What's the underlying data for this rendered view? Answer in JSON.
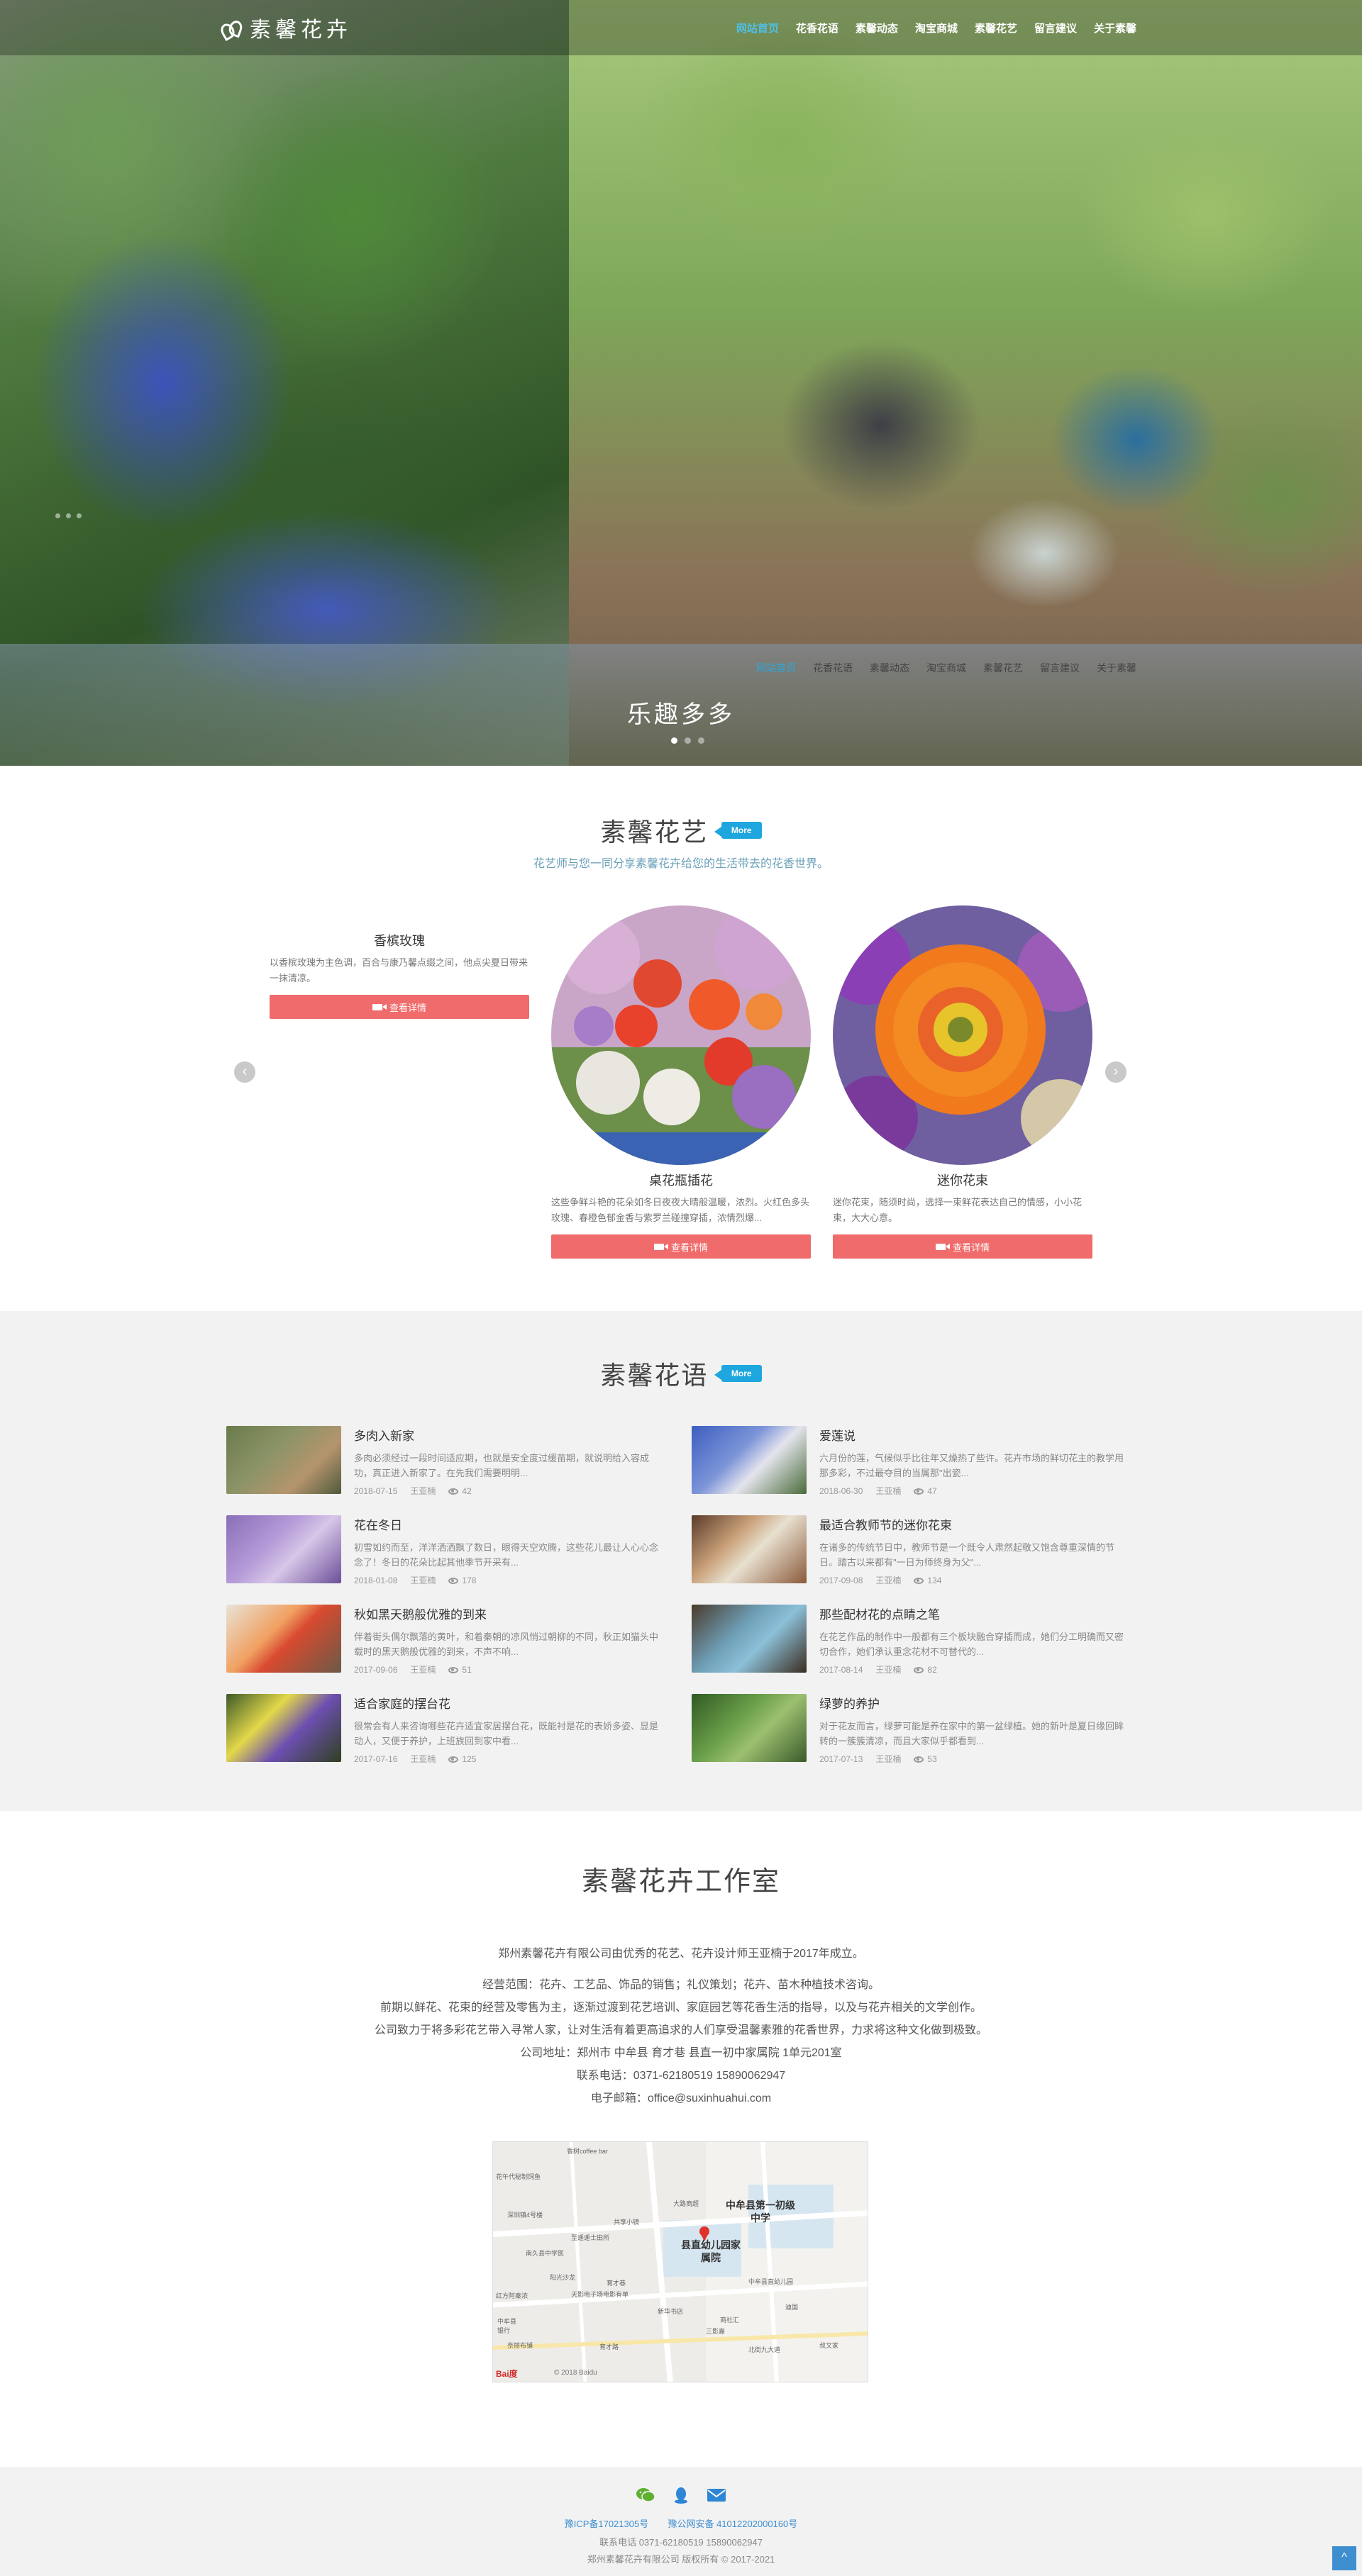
{
  "brand": {
    "name": "素馨花卉"
  },
  "nav": {
    "items": [
      "网站首页",
      "花香花语",
      "素馨动态",
      "淘宝商城",
      "素馨花艺",
      "留言建议",
      "关于素馨"
    ],
    "active_index": 0
  },
  "hero": {
    "caption": "乐趣多多",
    "subnav": [
      "网站首页",
      "花香花语",
      "素馨动态",
      "淘宝商城",
      "素馨花艺",
      "留言建议",
      "关于素馨"
    ],
    "slide_count": 3,
    "active_slide": 1
  },
  "arrangements": {
    "title": "素馨花艺",
    "more": "More",
    "subtitle": "花艺师与您一同分享素馨花卉给您的生活带去的花香世界。",
    "button_label": "查看详情",
    "cards": [
      {
        "name": "香槟玫瑰",
        "desc": "以香槟玫瑰为主色调，百合与康乃馨点缀之间，他点尖夏日带来一抹清凉。"
      },
      {
        "name": "桌花瓶插花",
        "desc": "这些争鲜斗艳的花朵如冬日夜夜大晴般温暖，浓烈。火红色多头玫瑰、春橙色郁金香与紫罗兰碰撞穿插，浓情烈爆..."
      },
      {
        "name": "迷你花束",
        "desc": "迷你花束，随须时尚，选择一束鲜花表达自己的情感，小小花束，大大心意。"
      }
    ],
    "colors": {
      "button": "#f06b6b",
      "accent": "#1ea6df"
    }
  },
  "flower_language": {
    "title": "素馨花语",
    "more": "More",
    "posts": [
      {
        "title": "多肉入新家",
        "excerpt": "多肉必须经过一段时间适应期，也就是安全度过缓苗期，就说明给入容成功，真正进入新家了。在先我们需要明明...",
        "date": "2018-07-15",
        "author": "王亚楠",
        "views": "42"
      },
      {
        "title": "爱莲说",
        "excerpt": "六月份的莲，气候似乎比往年又燥热了些许。花卉市场的鲜切花主的教学用那多彩，不过最夺目的当属那\"出瓷...",
        "date": "2018-06-30",
        "author": "王亚楠",
        "views": "47"
      },
      {
        "title": "花在冬日",
        "excerpt": "初雪如约而至，洋洋洒洒飘了数日，眼得天空欢腾，这些花儿最让人心心念念了！冬日的花朵比起其他季节开采有...",
        "date": "2018-01-08",
        "author": "王亚楠",
        "views": "178"
      },
      {
        "title": "最适合教师节的迷你花束",
        "excerpt": "在诸多的传统节日中，教师节是一个既令人肃然起敬又饱含尊重深情的节日。踏古以来都有\"一日为师终身为父\"...",
        "date": "2017-09-08",
        "author": "王亚楠",
        "views": "134"
      },
      {
        "title": "秋如黑天鹅般优雅的到来",
        "excerpt": "伴着街头偶尔飘落的黄叶，和着秦朝的凉风悄过朝柳的不同，秋正如猫头中载时的黑天鹅般优雅的到来，不声不响...",
        "date": "2017-09-06",
        "author": "王亚楠",
        "views": "51"
      },
      {
        "title": "那些配材花的点睛之笔",
        "excerpt": "在花艺作品的制作中一般都有三个板块融合穿插而成，她们分工明确而又密切合作，她们承认重念花材不可替代的...",
        "date": "2017-08-14",
        "author": "王亚楠",
        "views": "82"
      },
      {
        "title": "适合家庭的摆台花",
        "excerpt": "很常会有人来咨询哪些花卉适宜家居摆台花，既能衬是花的表娇多姿、显是动人，又便于养护，上班族回到家中看...",
        "date": "2017-07-16",
        "author": "王亚楠",
        "views": "125"
      },
      {
        "title": "绿萝的养护",
        "excerpt": "对于花友而言，绿萝可能是养在家中的第一盆绿植。她的新叶是夏日缘回眸转的一簇簇清凉，而且大家似乎都看到...",
        "date": "2017-07-13",
        "author": "王亚楠",
        "views": "53"
      }
    ]
  },
  "studio": {
    "title": "素馨花卉工作室",
    "lines": [
      "郑州素馨花卉有限公司由优秀的花艺、花卉设计师王亚楠于2017年成立。",
      "经营范围：花卉、工艺品、饰品的销售；礼仪策划；花卉、苗木种植技术咨询。",
      "前期以鲜花、花束的经营及零售为主，逐渐过渡到花艺培训、家庭园艺等花香生活的指导，以及与花卉相关的文学创作。",
      "公司致力于将多彩花艺带入寻常人家，让对生活有着更高追求的人们享受温馨素雅的花香世界，力求将这种文化做到极致。",
      "公司地址：郑州市 中牟县 育才巷 县直一初中家属院 1单元201室",
      "联系电话：0371-62180519  15890062947",
      "电子邮箱：office@suxinhuahui.com"
    ],
    "map": {
      "school": "中牟县第一初级中学",
      "kindergarten": "县直幼儿园家属院",
      "labels": [
        "香树coffee bar",
        "花午代秘制饲鱼",
        "深圳镇4号楼",
        "共享小镜",
        "至遥遥士田所",
        "南久县中学医",
        "阳光沙龙",
        "天影电子场电影有单",
        "红方阿秦浓",
        "育才巷",
        "育才路",
        "大路商超",
        "新华书店",
        "中牟县直幼儿园",
        "迪国",
        "商社汇",
        "三影嘉",
        "北街九大道",
        "叔文家",
        "中牟县银行",
        "奈丽布铺"
      ],
      "copyright": "© 2018 Baidu",
      "logo": "Bai度"
    }
  },
  "footer": {
    "icons": [
      "wechat-icon",
      "qq-icon",
      "email-icon"
    ],
    "icp": "豫ICP备17021305号",
    "police": "豫公网安备 41012202000160号",
    "phone": "联系电话 0371-62180519 15890062947",
    "copyright": "郑州素馨花卉有限公司 版权所有 © 2017-2021",
    "to_top": "^"
  }
}
